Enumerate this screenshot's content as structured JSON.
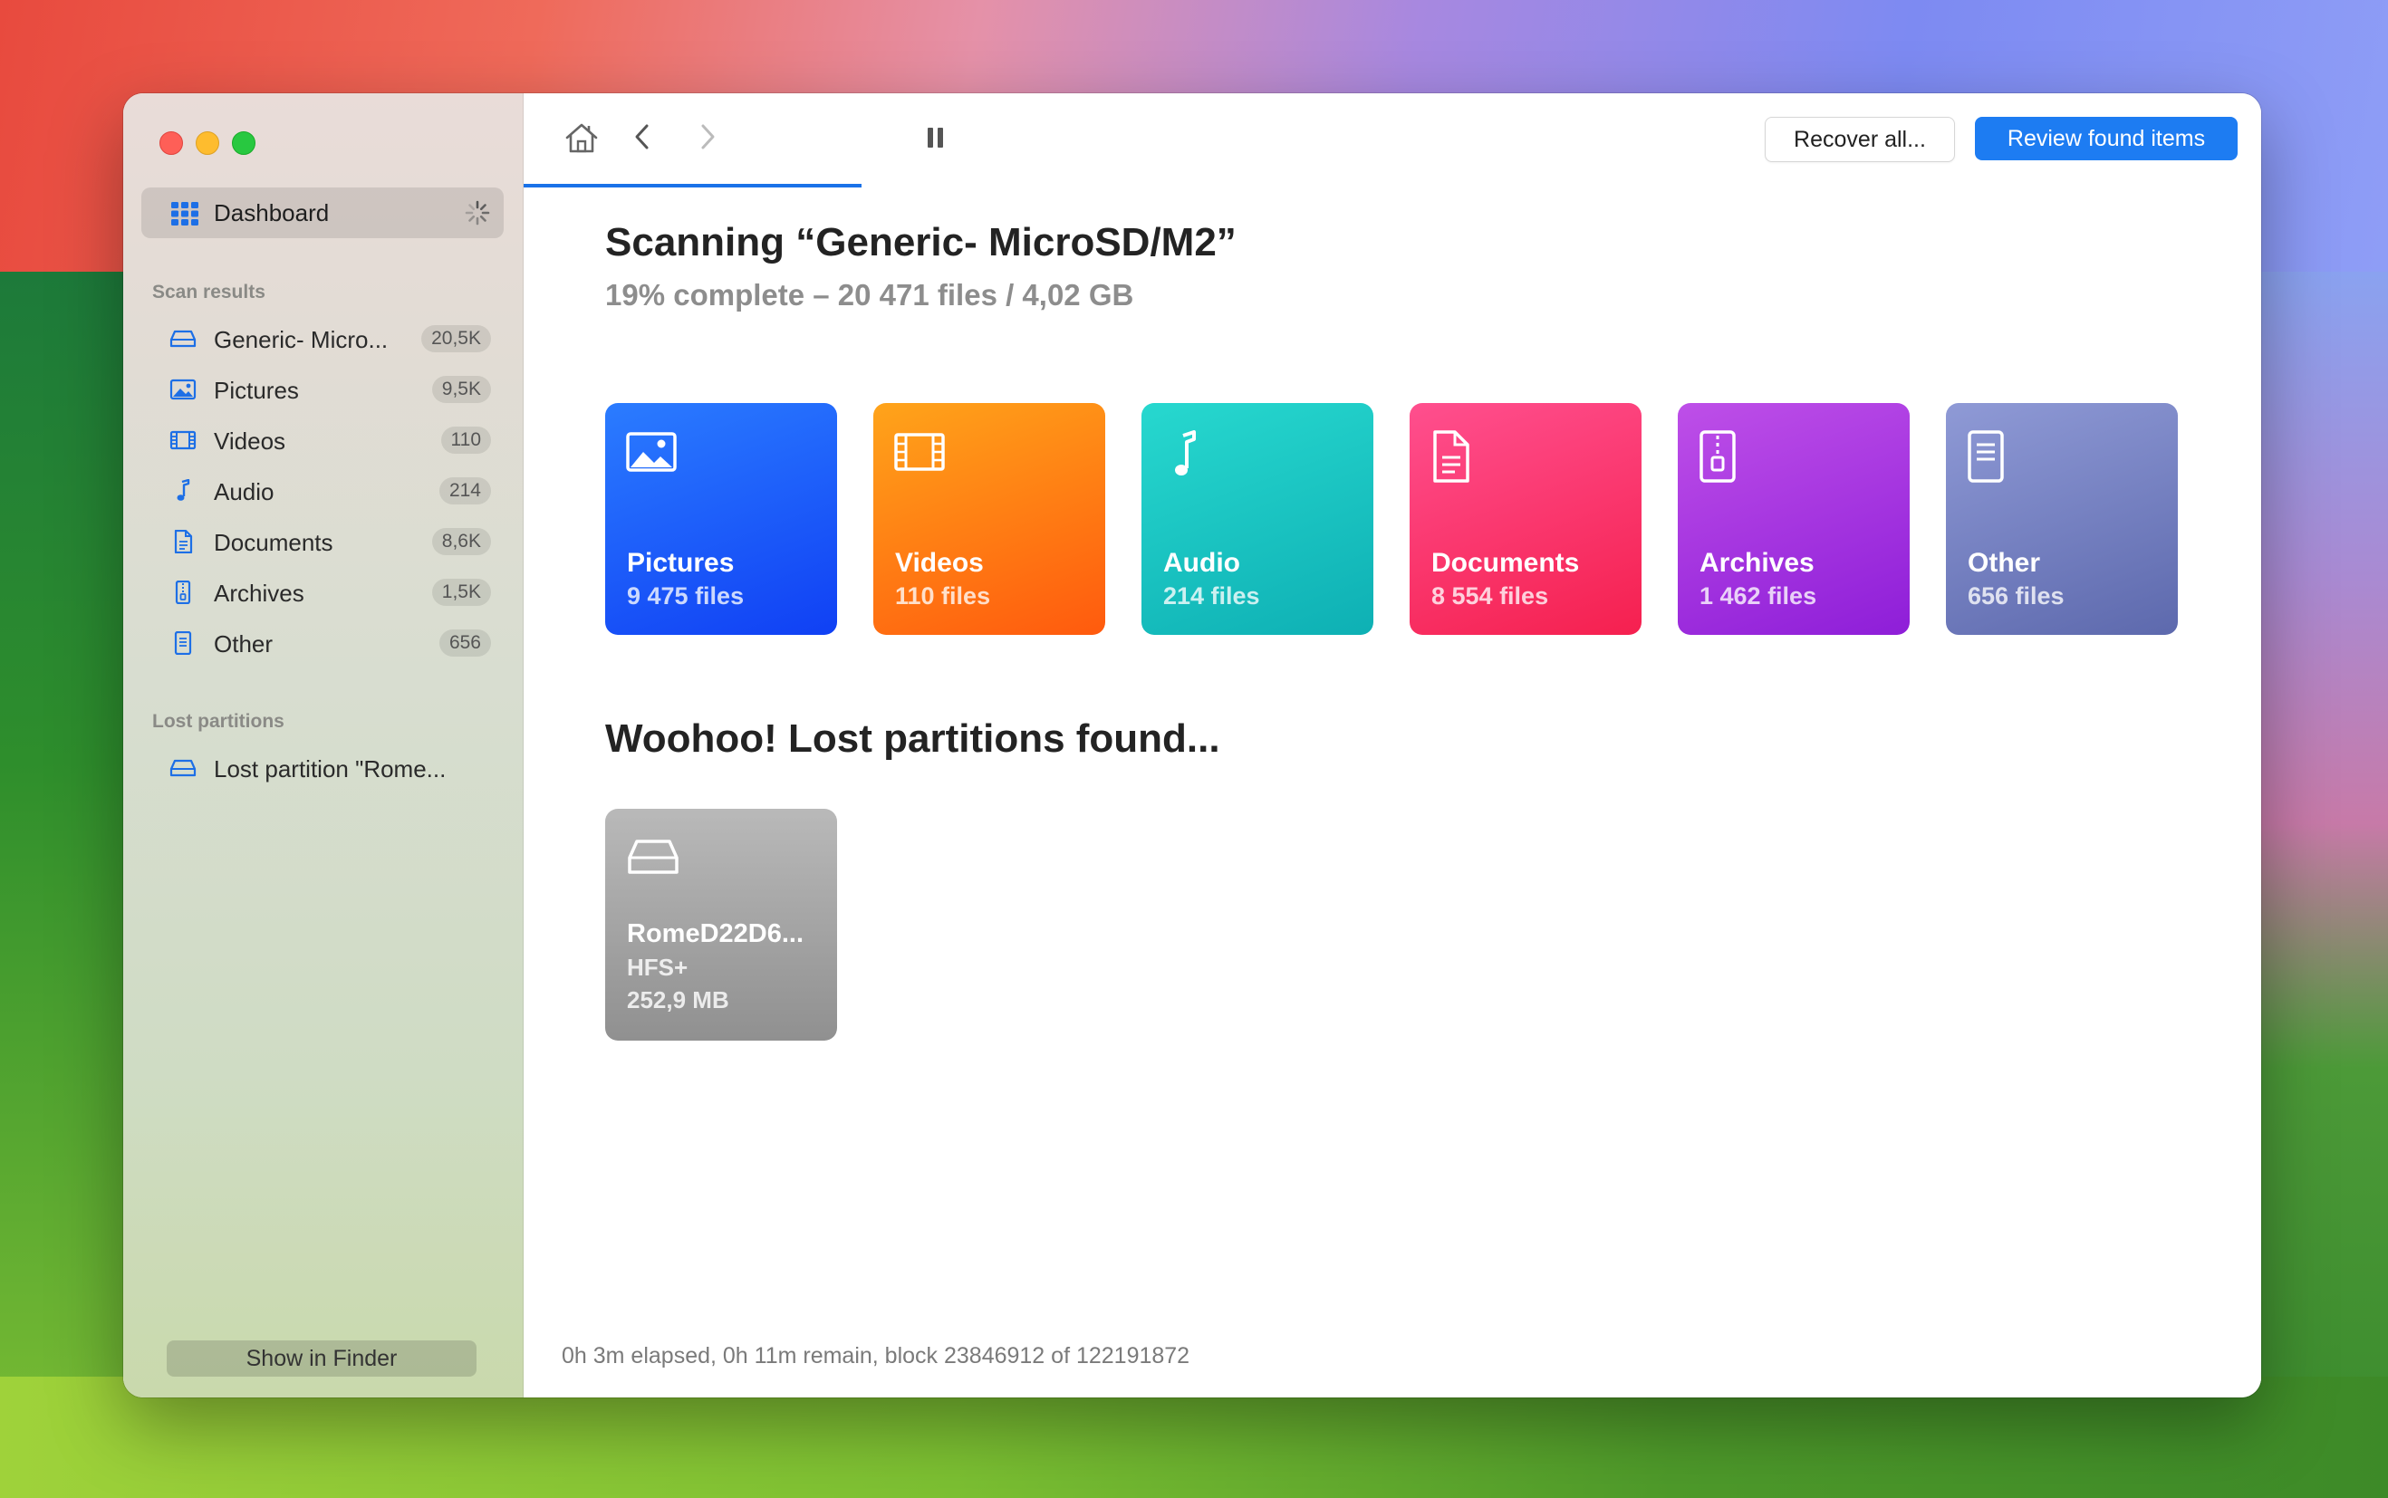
{
  "window_controls": {
    "close": "close",
    "minimize": "minimize",
    "zoom": "zoom"
  },
  "sidebar": {
    "dashboard_label": "Dashboard",
    "scan_results_heading": "Scan results",
    "items": [
      {
        "label": "Generic- Micro...",
        "count": "20,5K",
        "icon": "drive-icon"
      },
      {
        "label": "Pictures",
        "count": "9,5K",
        "icon": "picture-icon"
      },
      {
        "label": "Videos",
        "count": "110",
        "icon": "film-icon"
      },
      {
        "label": "Audio",
        "count": "214",
        "icon": "music-note-icon"
      },
      {
        "label": "Documents",
        "count": "8,6K",
        "icon": "document-icon"
      },
      {
        "label": "Archives",
        "count": "1,5K",
        "icon": "archive-icon"
      },
      {
        "label": "Other",
        "count": "656",
        "icon": "other-file-icon"
      }
    ],
    "lost_partitions_heading": "Lost partitions",
    "lost_partitions": [
      {
        "label": "Lost partition \"Rome..."
      }
    ],
    "show_in_finder": "Show in Finder"
  },
  "toolbar": {
    "recover_all": "Recover all...",
    "review_found_items": "Review found items"
  },
  "main": {
    "title": "Scanning “Generic- MicroSD/M2”",
    "subtitle": "19% complete – 20 471 files / 4,02 GB",
    "progress_percent": 19,
    "categories": [
      {
        "name": "Pictures",
        "count": "9 475 files"
      },
      {
        "name": "Videos",
        "count": "110 files"
      },
      {
        "name": "Audio",
        "count": "214 files"
      },
      {
        "name": "Documents",
        "count": "8 554 files"
      },
      {
        "name": "Archives",
        "count": "1 462 files"
      },
      {
        "name": "Other",
        "count": "656 files"
      }
    ],
    "lost_title": "Woohoo! Lost partitions found...",
    "partition": {
      "name": "RomeD22D6...",
      "fs": "HFS+",
      "size": "252,9 MB"
    },
    "status": "0h 3m elapsed, 0h 11m remain, block 23846912 of 122191872"
  },
  "colors": {
    "accent": "#1d7cf2",
    "pictures": "#1a55f6",
    "videos": "#ff7a12",
    "audio": "#1cc4c2",
    "documents": "#fa3468",
    "archives": "#a838e0",
    "other": "#7480c2"
  }
}
